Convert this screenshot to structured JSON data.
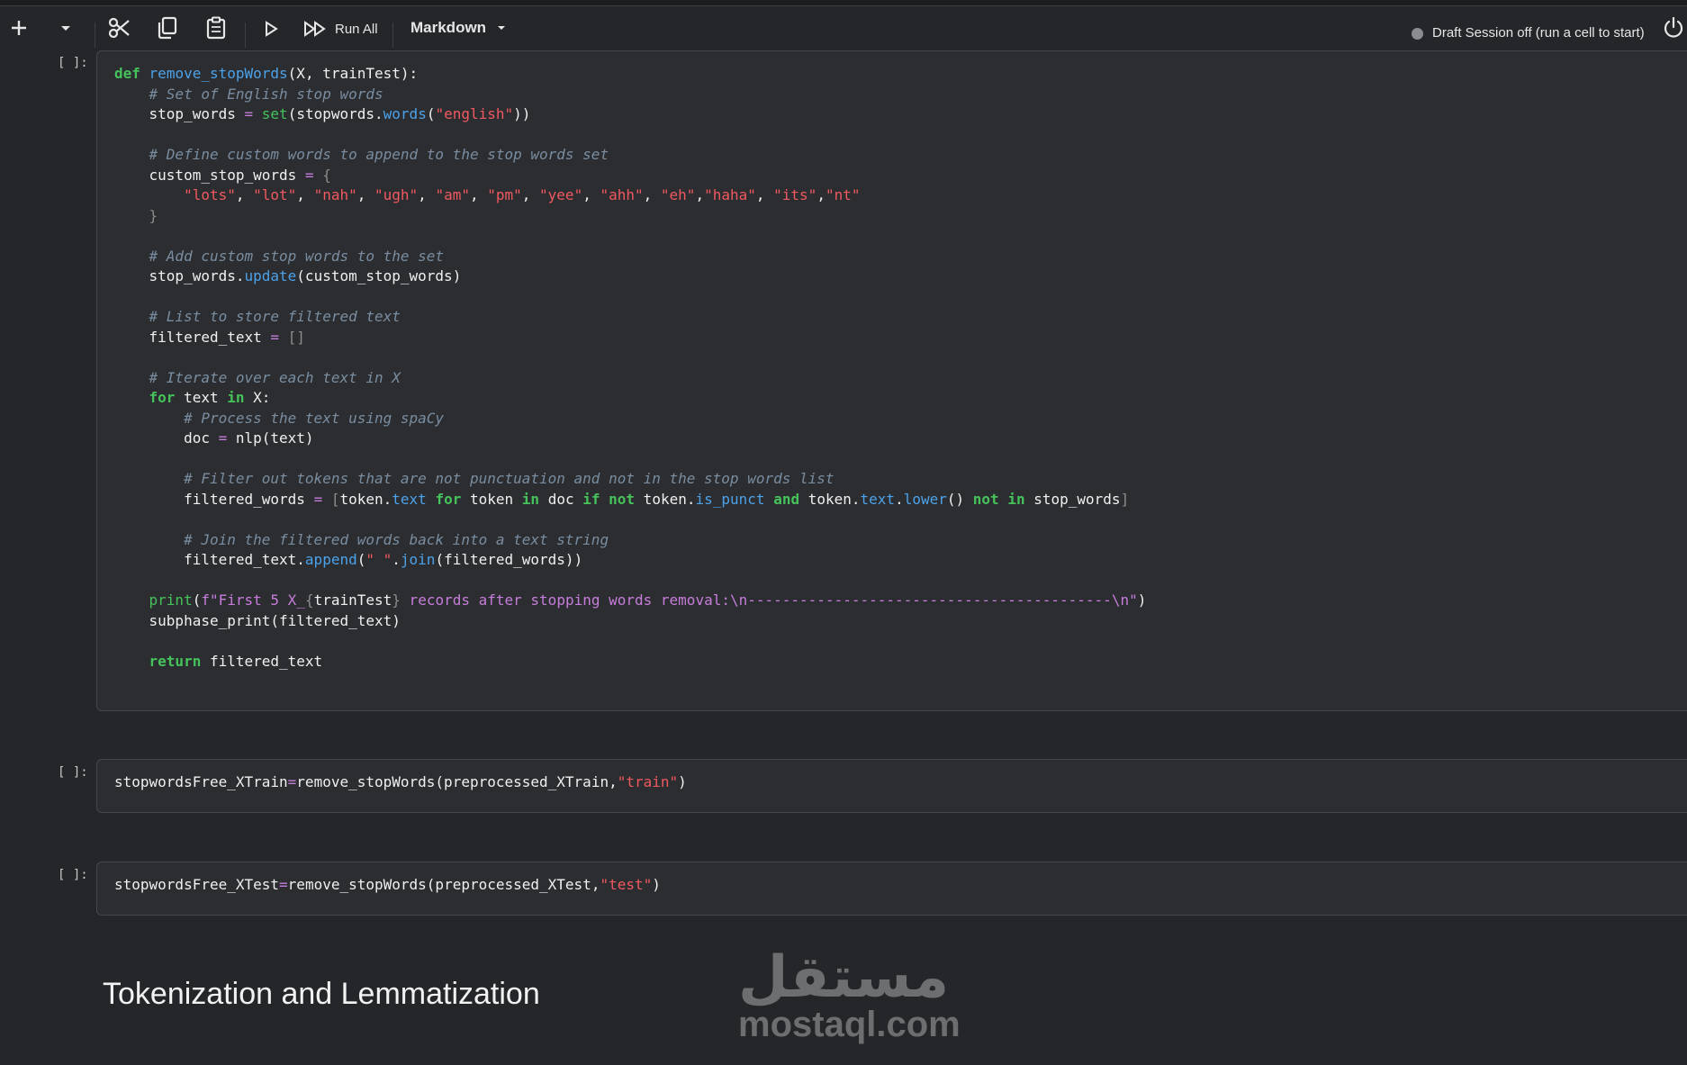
{
  "toolbar": {
    "add_icon": "plus-icon",
    "dropdown_icon": "chevron-down-icon",
    "cut_icon": "scissors-icon",
    "copy_icon": "copy-icon",
    "paste_icon": "clipboard-icon",
    "run_icon": "play-icon",
    "run_all_icon": "fast-forward-icon",
    "run_all_label": "Run All",
    "cell_type_label": "Markdown",
    "session_status": "Draft Session off (run a cell to start)",
    "power_icon": "power-icon"
  },
  "cells": [
    {
      "prompt": "[ ]:",
      "lines": [
        "def remove_stopWords(X, trainTest):",
        "    # Set of English stop words",
        "    stop_words = set(stopwords.words(\"english\"))",
        "",
        "    # Define custom words to append to the stop words set",
        "    custom_stop_words = {",
        "        \"lots\", \"lot\", \"nah\", \"ugh\", \"am\", \"pm\", \"yee\", \"ahh\", \"eh\",\"haha\", \"its\",\"nt\"",
        "    }",
        "",
        "    # Add custom stop words to the set",
        "    stop_words.update(custom_stop_words)",
        "",
        "    # List to store filtered text",
        "    filtered_text = []",
        "",
        "    # Iterate over each text in X",
        "    for text in X:",
        "        # Process the text using spaCy",
        "        doc = nlp(text)",
        "",
        "        # Filter out tokens that are not punctuation and not in the stop words list",
        "        filtered_words = [token.text for token in doc if not token.is_punct and token.text.lower() not in stop_words]",
        "",
        "        # Join the filtered words back into a text string",
        "        filtered_text.append(\" \".join(filtered_words))",
        "",
        "    print(f\"First 5 X_{trainTest} records after stopping words removal:\\n------------------------------------------\\n\")",
        "    subphase_print(filtered_text)",
        "",
        "    return filtered_text"
      ]
    },
    {
      "prompt": "[ ]:",
      "lines": [
        "stopwordsFree_XTrain=remove_stopWords(preprocessed_XTrain,\"train\")"
      ]
    },
    {
      "prompt": "[ ]:",
      "lines": [
        "stopwordsFree_XTest=remove_stopWords(preprocessed_XTest,\"test\")"
      ]
    }
  ],
  "markdown": {
    "heading": "Tokenization and Lemmatization"
  },
  "watermark": {
    "arabic": "مستقل",
    "latin": "mostaql.com"
  },
  "colors": {
    "background": "#242629",
    "cell_background": "#2b2d30",
    "keyword": "#46c25b",
    "function": "#4ca2ea",
    "string": "#f0595f",
    "fstring": "#c77ddb",
    "comment": "#7a8da0"
  }
}
